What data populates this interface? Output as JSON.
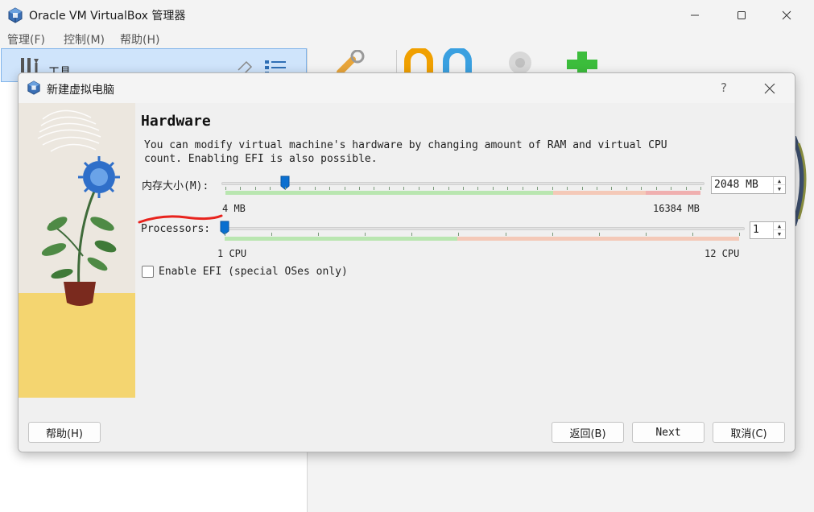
{
  "window": {
    "title": "Oracle VM VirtualBox 管理器"
  },
  "menu": {
    "items": [
      "管理(F)",
      "控制(M)",
      "帮助(H)"
    ]
  },
  "sidebar": {
    "tools_label": "工具"
  },
  "dialog": {
    "title": "新建虚拟电脑",
    "help_glyph": "?",
    "section_title": "Hardware",
    "description": "You can modify virtual machine's hardware by changing amount of RAM and virtual CPU count. Enabling EFI is also possible.",
    "memory": {
      "label": "内存大小(M):",
      "value": "2048 MB",
      "min_label": "4 MB",
      "max_label": "16384 MB",
      "value_mb": 2048,
      "min_mb": 4,
      "max_mb": 16384
    },
    "processors": {
      "label": "Processors:",
      "value": "1",
      "min_label": "1 CPU",
      "max_label": "12 CPU",
      "count": 1,
      "min": 1,
      "max": 12
    },
    "efi": {
      "label": "Enable EFI (special OSes only)",
      "checked": false
    },
    "buttons": {
      "help": "帮助(H)",
      "back": "返回(B)",
      "next": "Next",
      "cancel": "取消(C)"
    }
  },
  "colors": {
    "accent": "#0a6fd0",
    "slider_safe": "#b9e6b0",
    "slider_warn": "#f4c9b8",
    "slider_danger": "#f0b0b0",
    "annotation": "#e8231d"
  }
}
